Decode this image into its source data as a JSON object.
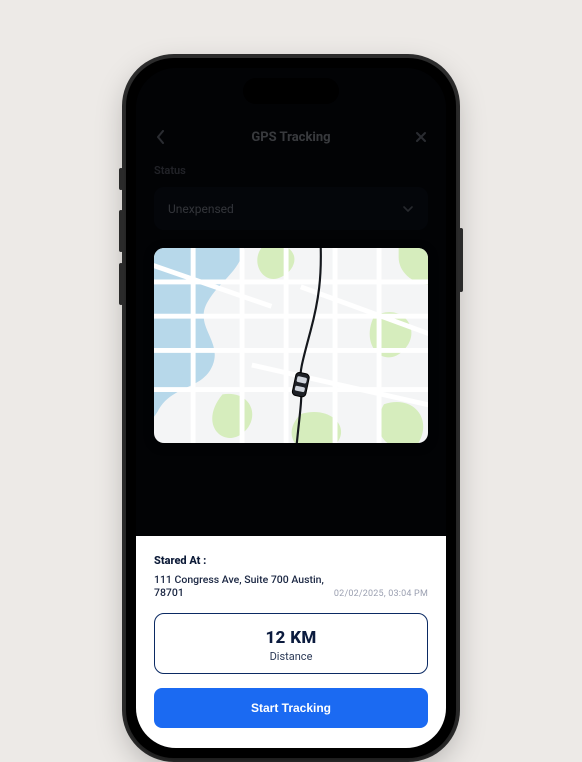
{
  "header": {
    "title": "GPS Tracking"
  },
  "status": {
    "label": "Status",
    "selected": "Unexpensed"
  },
  "sheet": {
    "started_label": "Stared At :",
    "address": "111 Congress Ave, Suite 700 Austin, 78701",
    "timestamp": "02/02/2025,  03:04 PM",
    "distance_value": "12 KM",
    "distance_label": "Distance",
    "track_button": "Start Tracking"
  },
  "colors": {
    "accent": "#1b6af2",
    "border_dark": "#0b2a63"
  }
}
